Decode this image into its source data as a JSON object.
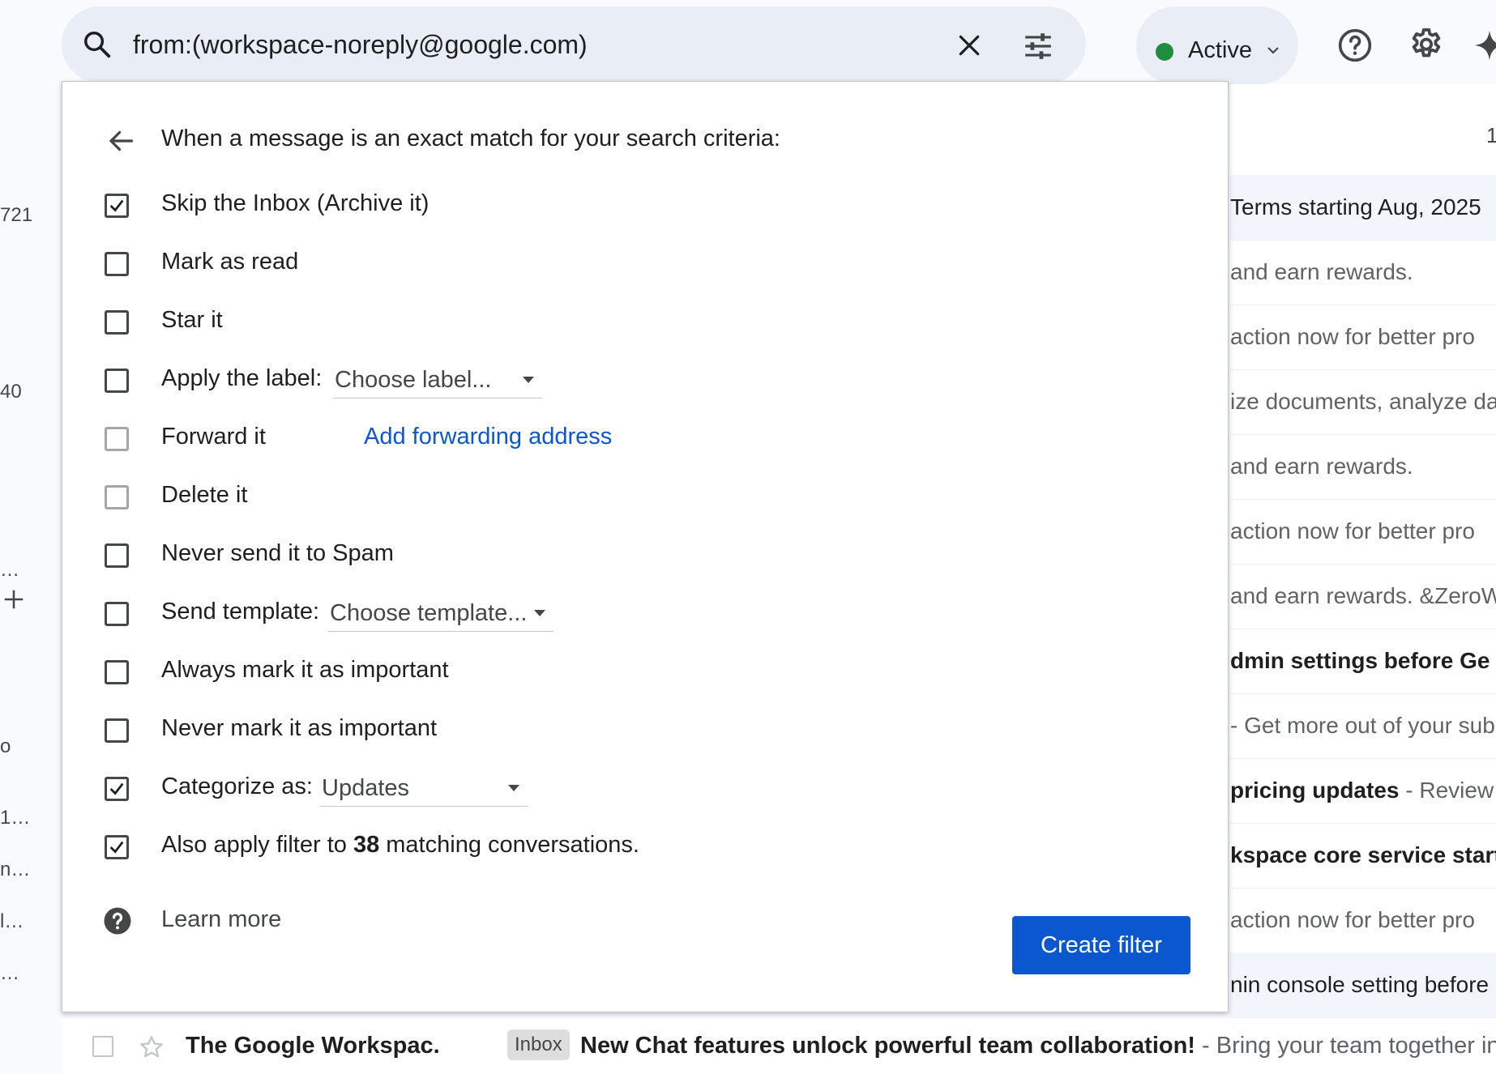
{
  "search": {
    "query": "from:(workspace-noreply@google.com)"
  },
  "status": {
    "label": "Active",
    "color": "#1e8e3e"
  },
  "left_rail": {
    "fragments": [
      "721",
      "40",
      "…",
      "o",
      "1…",
      "n…",
      "l…",
      "…"
    ]
  },
  "mail_list": {
    "page_count": "1",
    "rows": [
      {
        "text": "Terms starting Aug, 2025",
        "style": "highlight"
      },
      {
        "text": "and earn rewards.",
        "style": "normal"
      },
      {
        "text": " action now for better pro",
        "style": "normal"
      },
      {
        "text": "ize documents, analyze da",
        "style": "normal"
      },
      {
        "text": "and earn rewards.",
        "style": "normal"
      },
      {
        "text": " action now for better pro",
        "style": "normal"
      },
      {
        "text": "and earn rewards. &ZeroW",
        "style": "normal"
      },
      {
        "text": "dmin settings before Ge",
        "style": "bold"
      },
      {
        "text": "- Get more out of your sub",
        "style": "normal"
      },
      {
        "text": "pricing updates",
        "snippet": " - Review",
        "style": "mixed"
      },
      {
        "text": "kspace core service start",
        "style": "bold"
      },
      {
        "text": " action now for better pro",
        "style": "normal"
      },
      {
        "text": "nin console setting before",
        "style": "highlight"
      }
    ],
    "bottom_row": {
      "sender": "The Google Workspac.",
      "badge": "Inbox",
      "subject": "New Chat features unlock powerful team collaboration!",
      "snippet": " - Bring your team together in"
    }
  },
  "dialog": {
    "header": "When a message is an exact match for your search criteria:",
    "options": [
      {
        "label": "Skip the Inbox (Archive it)",
        "checked": true
      },
      {
        "label": "Mark as read",
        "checked": false
      },
      {
        "label": "Star it",
        "checked": false
      },
      {
        "label": "Apply the label:",
        "checked": false,
        "dropdown": "Choose label..."
      },
      {
        "label": "Forward it",
        "checked": false,
        "disabled": true,
        "link": "Add forwarding address"
      },
      {
        "label": "Delete it",
        "checked": false,
        "disabled": true
      },
      {
        "label": "Never send it to Spam",
        "checked": false
      },
      {
        "label": "Send template:",
        "checked": false,
        "dropdown": "Choose template..."
      },
      {
        "label": "Always mark it as important",
        "checked": false
      },
      {
        "label": "Never mark it as important",
        "checked": false
      },
      {
        "label": "Categorize as:",
        "checked": true,
        "dropdown": "Updates"
      },
      {
        "label_prefix": "Also apply filter to ",
        "count": "38",
        "label_suffix": " matching conversations.",
        "checked": true
      }
    ],
    "learn_more": "Learn more",
    "create_button": "Create filter",
    "accent_color": "#0b57d0"
  }
}
